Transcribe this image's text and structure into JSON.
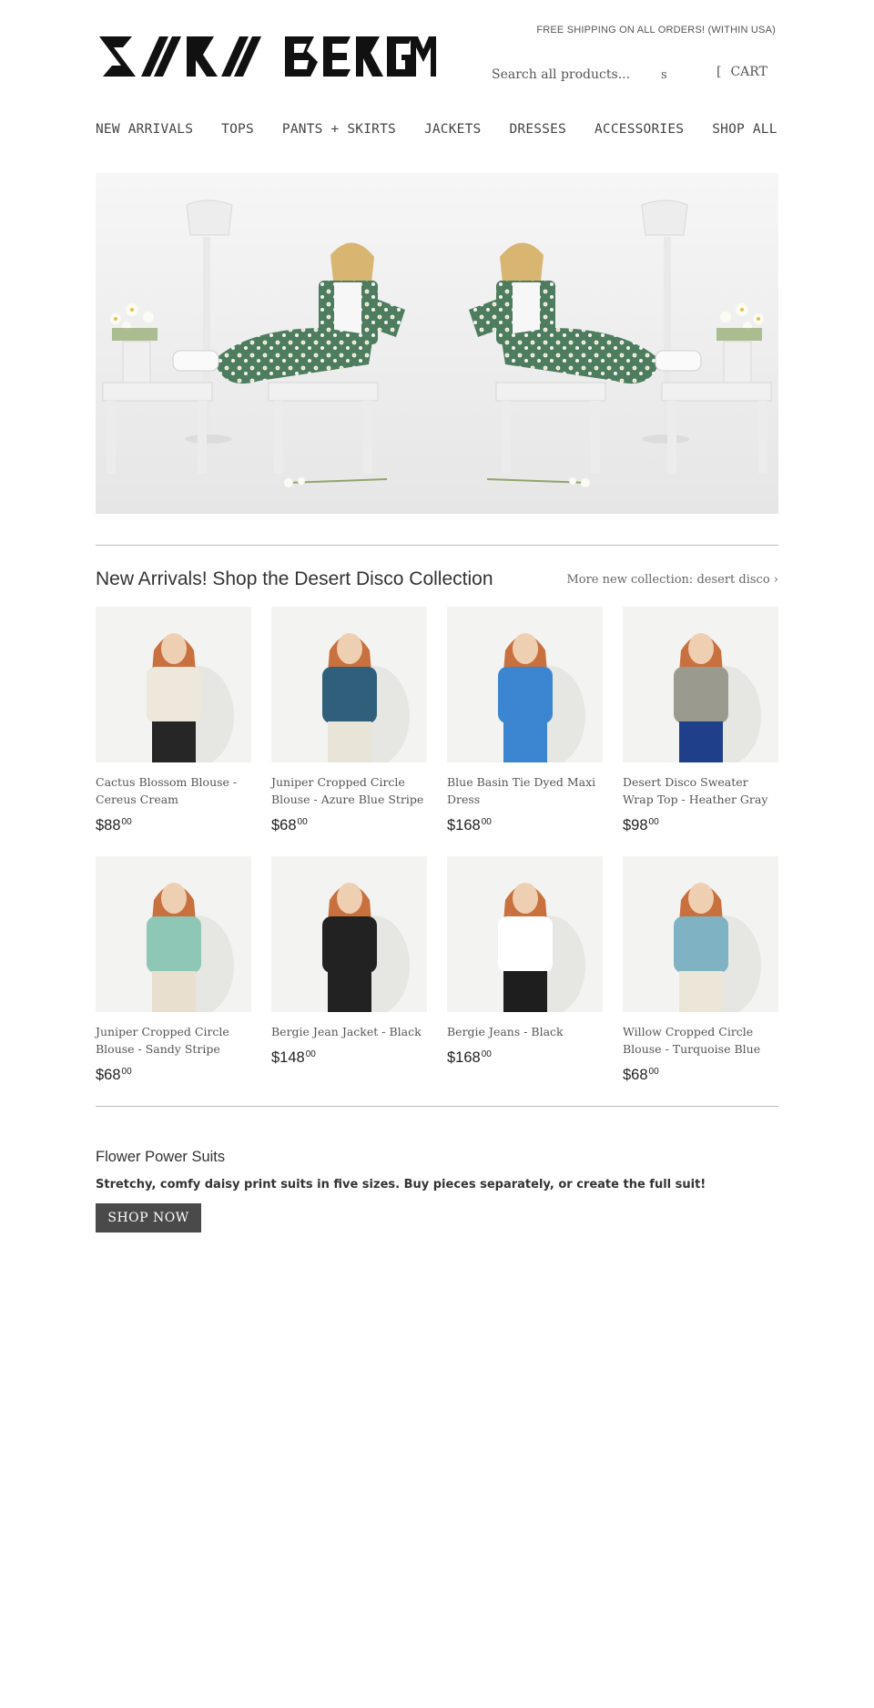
{
  "header": {
    "brand": "SARA BERGMAN",
    "shipping_notice": "FREE SHIPPING ON ALL ORDERS! (WITHIN USA)",
    "search_placeholder": "Search all products...",
    "search_icon": "s",
    "cart_icon": "[",
    "cart_label": "CART"
  },
  "nav": {
    "items": [
      {
        "label": "NEW ARRIVALS"
      },
      {
        "label": "TOPS"
      },
      {
        "label": "PANTS + SKIRTS"
      },
      {
        "label": "JACKETS"
      },
      {
        "label": "DRESSES"
      },
      {
        "label": "ACCESSORIES"
      },
      {
        "label": "SHOP ALL"
      }
    ]
  },
  "collection": {
    "title": "New Arrivals! Shop the Desert Disco Collection",
    "more_link": "More new collection: desert disco ›",
    "products": [
      {
        "title": "Cactus Blossom Blouse - Cereus Cream",
        "price": "$88",
        "cents": "00",
        "top": "#ede7dc",
        "bottom": "#262626"
      },
      {
        "title": "Juniper Cropped Circle Blouse - Azure Blue Stripe",
        "price": "$68",
        "cents": "00",
        "top": "#2f5f7a",
        "bottom": "#e9e4d8"
      },
      {
        "title": "Blue Basin Tie Dyed Maxi Dress",
        "price": "$168",
        "cents": "00",
        "top": "#3c86d1",
        "bottom": "#3c86d1"
      },
      {
        "title": "Desert Disco Sweater Wrap Top - Heather Gray",
        "price": "$98",
        "cents": "00",
        "top": "#9a9b8e",
        "bottom": "#1f3f8a"
      },
      {
        "title": "Juniper Cropped Circle Blouse - Sandy Stripe",
        "price": "$68",
        "cents": "00",
        "top": "#8fc7b6",
        "bottom": "#e8dfcf"
      },
      {
        "title": "Bergie Jean Jacket - Black",
        "price": "$148",
        "cents": "00",
        "top": "#222222",
        "bottom": "#222222"
      },
      {
        "title": "Bergie Jeans - Black",
        "price": "$168",
        "cents": "00",
        "top": "#ffffff",
        "bottom": "#1e1e1e"
      },
      {
        "title": "Willow Cropped Circle Blouse - Turquoise Blue",
        "price": "$68",
        "cents": "00",
        "top": "#7fb2c2",
        "bottom": "#ece6d9"
      }
    ]
  },
  "promo": {
    "title": "Flower Power Suits",
    "text": "Stretchy, comfy daisy print suits in five sizes. Buy pieces separately, or create the full suit!",
    "button_label": "SHOP NOW"
  },
  "colors": {
    "accent_button": "#4a4a4a",
    "suit_green": "#4d7c5f"
  }
}
